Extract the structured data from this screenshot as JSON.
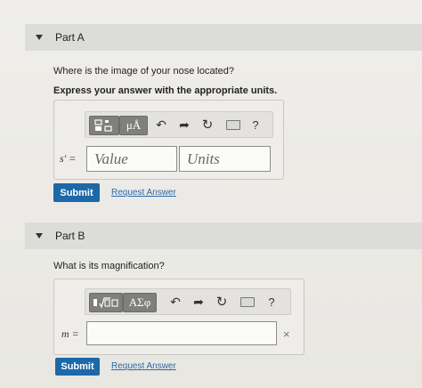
{
  "partA": {
    "title": "Part A",
    "question": "Where is the image of your nose located?",
    "instruction": "Express your answer with the appropriate units.",
    "toolbar": {
      "template_icon": "template-icon",
      "units_label": "μÅ",
      "undo_icon": "undo-icon",
      "redo_icon": "redo-icon",
      "reset_icon": "reset-icon",
      "keyboard_icon": "keyboard-icon",
      "help_label": "?"
    },
    "variable_label": "s′ =",
    "value_placeholder": "Value",
    "units_placeholder": "Units",
    "submit_label": "Submit",
    "request_answer_label": "Request Answer"
  },
  "partB": {
    "title": "Part B",
    "question": "What is its magnification?",
    "toolbar": {
      "template_icon": "template-sqrt-icon",
      "greek_label": "ΑΣφ",
      "undo_icon": "undo-icon",
      "redo_icon": "redo-icon",
      "reset_icon": "reset-icon",
      "keyboard_icon": "keyboard-icon",
      "help_label": "?"
    },
    "variable_label": "m =",
    "answer_value": "",
    "close_label": "×",
    "submit_label": "Submit",
    "request_answer_label": "Request Answer"
  },
  "colors": {
    "submit_bg": "#1d68a8",
    "link": "#2e69a8",
    "header_bg": "#dcdcd8"
  }
}
